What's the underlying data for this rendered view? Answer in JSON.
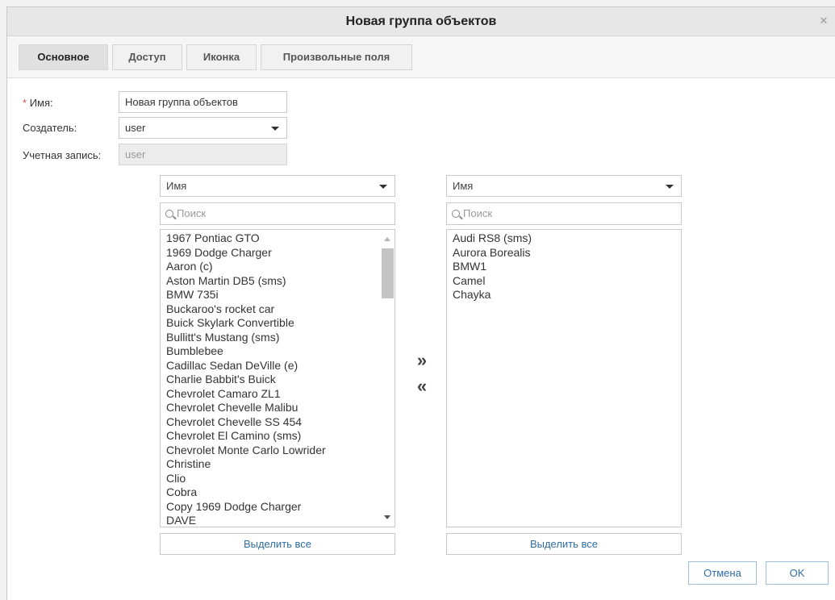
{
  "dialog": {
    "title": "Новая группа объектов"
  },
  "tabs": [
    {
      "label": "Основное"
    },
    {
      "label": "Доступ"
    },
    {
      "label": "Иконка"
    },
    {
      "label": "Произвольные поля"
    }
  ],
  "form": {
    "name_label": "Имя:",
    "name_required_mark": "*",
    "name_value": "Новая группа объектов",
    "creator_label": "Создатель:",
    "creator_value": "user",
    "account_label": "Учетная запись:",
    "account_value": "user"
  },
  "left_list": {
    "sort_value": "Имя",
    "search_placeholder": "Поиск",
    "select_all": "Выделить все",
    "items": [
      "1967 Pontiac GTO",
      "1969 Dodge Charger",
      "Aaron (c)",
      "Aston Martin DB5 (sms)",
      "BMW 735i",
      "Buckaroo's rocket car",
      "Buick Skylark Convertible",
      "Bullitt's Mustang (sms)",
      "Bumblebee",
      "Cadillac Sedan DeVille (e)",
      "Charlie Babbit's Buick",
      "Chevrolet Camaro ZL1",
      "Chevrolet Chevelle Malibu",
      "Chevrolet Chevelle SS 454",
      "Chevrolet El Camino (sms)",
      "Chevrolet Monte Carlo Lowrider",
      "Christine",
      "Clio",
      "Cobra",
      "Copy 1969 Dodge Charger",
      "DAVE"
    ]
  },
  "right_list": {
    "sort_value": "Имя",
    "search_placeholder": "Поиск",
    "select_all": "Выделить все",
    "items": [
      "Audi RS8 (sms)",
      "Aurora Borealis",
      "BMW1",
      "Camel",
      "Chayka"
    ]
  },
  "transfer": {
    "add": "»",
    "remove": "«"
  },
  "footer": {
    "cancel": "Отмена",
    "ok": "OK"
  },
  "colors": {
    "link": "#2e6da4",
    "required": "#d9534f",
    "active_tab": "#e0e0e0"
  }
}
